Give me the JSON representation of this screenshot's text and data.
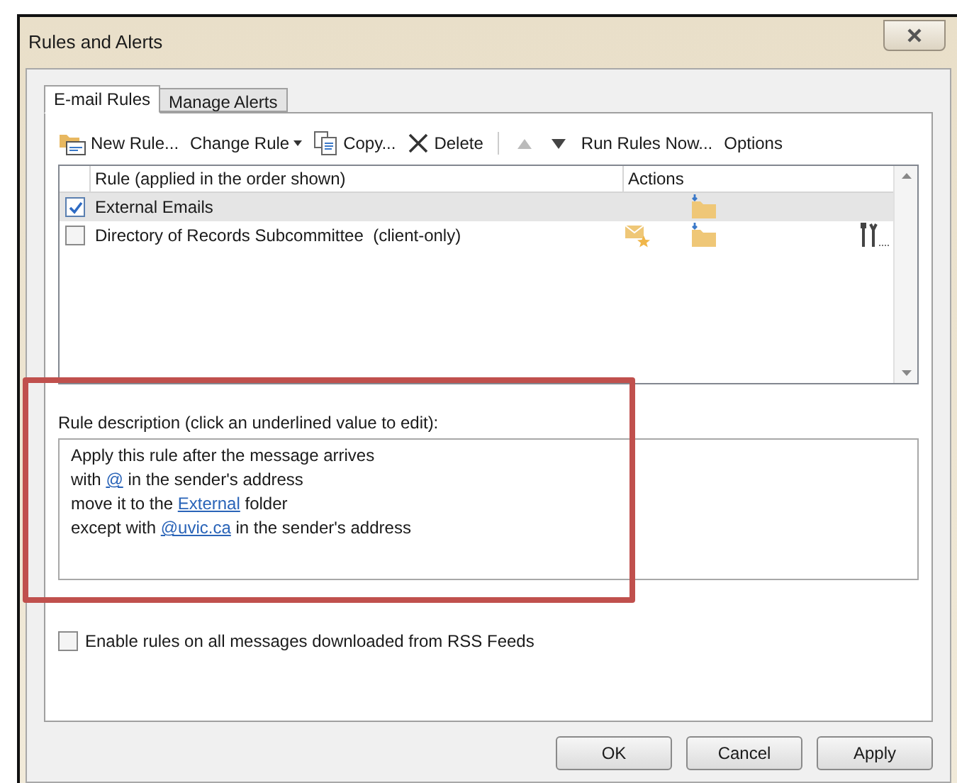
{
  "window": {
    "title": "Rules and Alerts"
  },
  "tabs": [
    {
      "label": "E-mail Rules",
      "selected": true
    },
    {
      "label": "Manage Alerts",
      "selected": false
    }
  ],
  "toolbar": [
    {
      "kind": "new",
      "label": "New Rule..."
    },
    {
      "kind": "change",
      "label": "Change Rule"
    },
    {
      "kind": "copy",
      "label": "Copy..."
    },
    {
      "kind": "delete",
      "label": "Delete"
    },
    {
      "kind": "separator"
    },
    {
      "kind": "up"
    },
    {
      "kind": "down"
    },
    {
      "kind": "text",
      "label": "Run Rules Now..."
    },
    {
      "kind": "text",
      "label": "Options"
    }
  ],
  "rules_table": {
    "columns": [
      "Rule (applied in the order shown)",
      "Actions"
    ],
    "rows": [
      {
        "name": "External Emails",
        "checked": true,
        "selected": true,
        "alert_action": false,
        "move_action": true,
        "tool_action": false
      },
      {
        "name": "Directory of Records Subcommittee  (client-only)",
        "checked": false,
        "selected": false,
        "alert_action": true,
        "move_action": true,
        "tool_action": true
      }
    ]
  },
  "description": {
    "label": "Rule description (click an underlined value to edit):",
    "lines": [
      [
        {
          "text": "Apply this rule after the message arrives",
          "link": false
        }
      ],
      [
        {
          "text": "with ",
          "link": false
        },
        {
          "text": "@",
          "link": true
        },
        {
          "text": " in the sender's address",
          "link": false
        }
      ],
      [
        {
          "text": "move it to the ",
          "link": false
        },
        {
          "text": "External",
          "link": true
        },
        {
          "text": " folder",
          "link": false
        }
      ],
      [
        {
          "text": "except with ",
          "link": false
        },
        {
          "text": "@uvic.ca",
          "link": true
        },
        {
          "text": " in the sender's address",
          "link": false
        }
      ]
    ]
  },
  "rss_option": {
    "label": "Enable rules on all messages downloaded from RSS Feeds",
    "checked": false
  },
  "buttons": [
    "OK",
    "Cancel",
    "Apply"
  ]
}
